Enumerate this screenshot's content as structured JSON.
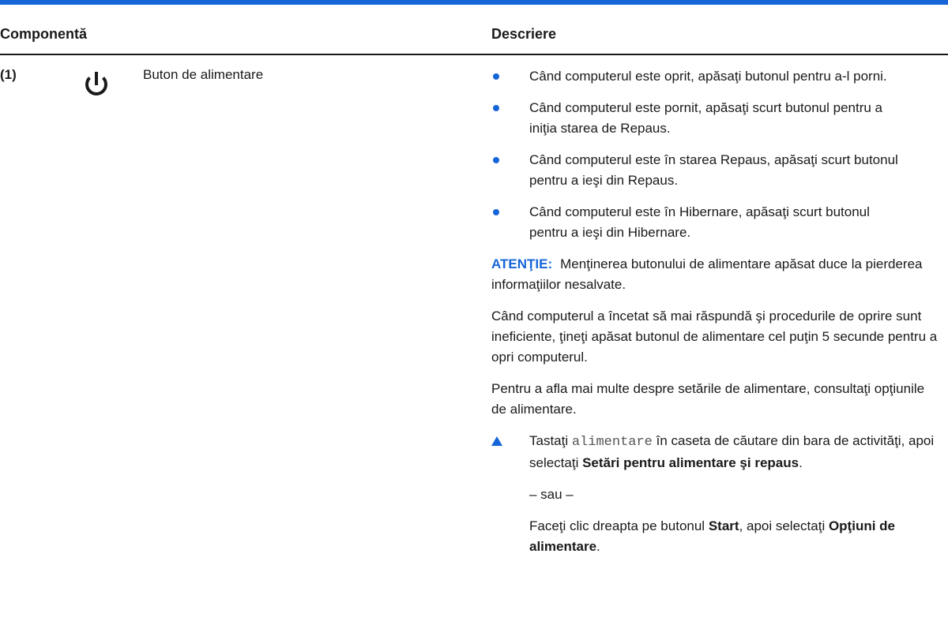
{
  "colors": {
    "accent": "#1565d8",
    "text": "#1a1a1a",
    "mono_text": "#555555"
  },
  "table": {
    "headers": {
      "component": "Componentă",
      "description": "Descriere"
    },
    "row": {
      "number": "(1)",
      "icon": "power-icon",
      "name": "Buton de alimentare",
      "bullets": [
        "Când computerul este oprit, apăsaţi butonul pentru a-l porni.",
        "Când computerul este pornit, apăsaţi scurt butonul pentru a iniţia starea de Repaus.",
        "Când computerul este în starea Repaus, apăsaţi scurt butonul pentru a ieşi din Repaus.",
        "Când computerul este în Hibernare, apăsaţi scurt butonul pentru a ieşi din Hibernare."
      ],
      "caution": {
        "label": "ATENŢIE:",
        "text": "Menţinerea butonului de alimentare apăsat duce la pierderea informaţiilor nesalvate."
      },
      "paragraph1": "Când computerul a încetat să mai răspundă şi procedurile de oprire sunt ineficiente, ţineţi apăsat butonul de alimentare cel puţin 5 secunde pentru a opri computerul.",
      "paragraph2": "Pentru a afla mai multe despre setările de alimentare, consultaţi opţiunile de alimentare.",
      "step": {
        "prefix": "Tastaţi ",
        "code": "alimentare",
        "middle": " în caseta de căutare din bara de activităţi, apoi selectaţi ",
        "bold": "Setări pentru alimentare şi repaus",
        "suffix": "."
      },
      "or": "– sau –",
      "alt": {
        "prefix": "Faceţi clic dreapta pe butonul ",
        "bold1": "Start",
        "middle": ", apoi selectaţi ",
        "bold2": "Opţiuni de alimentare",
        "suffix": "."
      }
    }
  }
}
